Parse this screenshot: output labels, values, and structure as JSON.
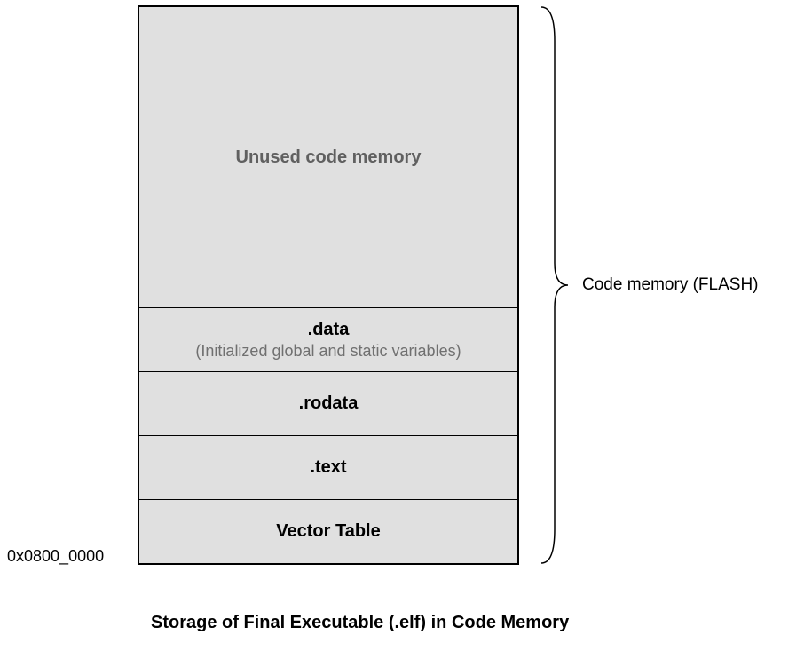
{
  "segments": {
    "unused": {
      "title": "Unused code memory"
    },
    "data": {
      "title": ".data",
      "subtitle": "(Initialized global and static variables)"
    },
    "rodata": {
      "title": ".rodata"
    },
    "text": {
      "title": ".text"
    },
    "vector": {
      "title": "Vector Table"
    }
  },
  "addressLabel": "0x0800_0000",
  "braceLabel": "Code memory (FLASH)",
  "caption": "Storage of Final Executable (.elf) in Code Memory"
}
